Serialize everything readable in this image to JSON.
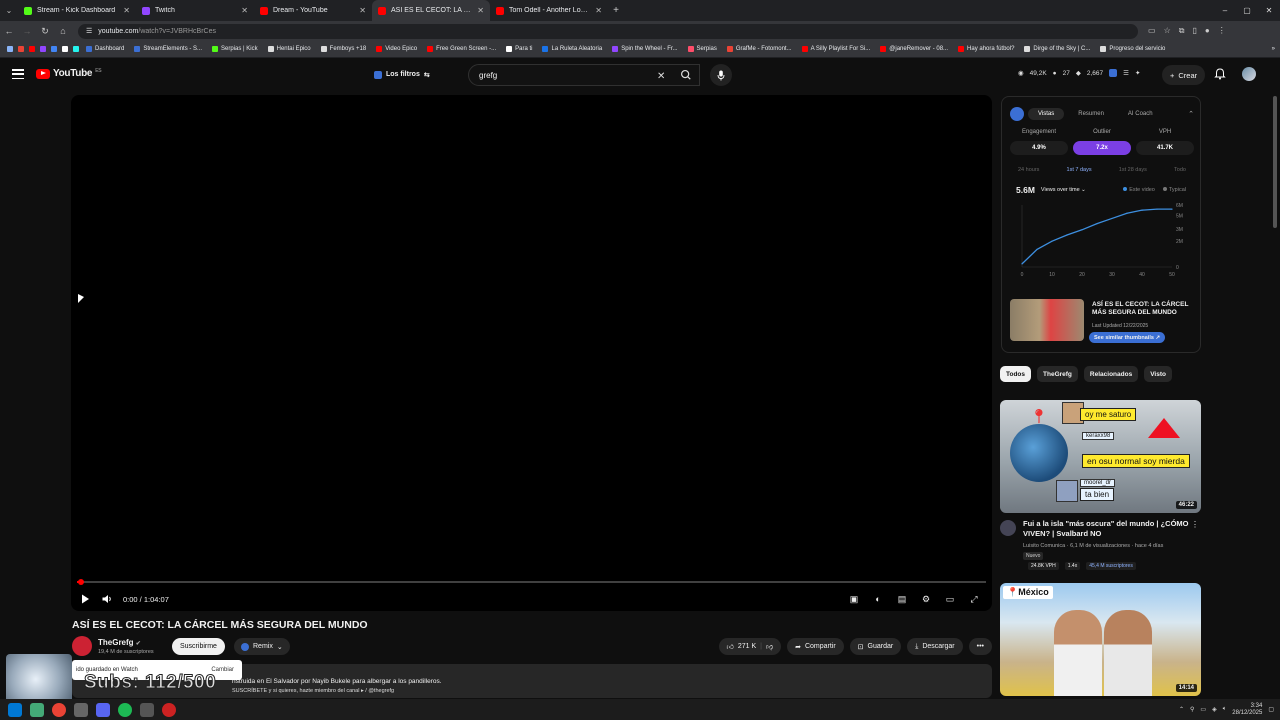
{
  "browser": {
    "tabs": [
      {
        "title": "Stream - Kick Dashboard",
        "color": "#53fc18"
      },
      {
        "title": "Twitch",
        "color": "#9146ff"
      },
      {
        "title": "Dream - YouTube",
        "color": "#ff0000"
      },
      {
        "title": "ASÍ ES EL CECOT: LA CÁRCEL M",
        "color": "#ff0000"
      },
      {
        "title": "Tom Odell - Another Love (sub",
        "color": "#ff0000"
      }
    ],
    "active_tab": 3,
    "url_host": "youtube.com",
    "url_path": "/watch?v=JVBRHcBrCes",
    "bookmarks": [
      "Dashboard",
      "StreamElements - S...",
      "Serpias | Kick",
      "Hentai Epico",
      "Femboys +18",
      "Video Epico",
      "Free Green Screen -...",
      "Para ti",
      "La Ruleta Aleatoria",
      "Spin the Wheel - Fr...",
      "Serpias",
      "GrafMe - Fotomont...",
      "A Silly Playlist For Si...",
      "@janeRemover - 08...",
      "Hay ahora fútbol?",
      "Dirge of the Sky | C...",
      "Progreso del servicio"
    ]
  },
  "header": {
    "logo_text": "YouTube",
    "logo_sup": "ES",
    "filters_label": "Los filtros",
    "search_value": "grefg",
    "stats": [
      "49,2K",
      "27",
      "2,667"
    ],
    "create_label": "Crear"
  },
  "player": {
    "time": "0:00 / 1:04:07",
    "progress_fraction": 0.004
  },
  "video": {
    "title": "ASÍ ES EL CECOT: LA CÁRCEL MÁS SEGURA DEL MUNDO",
    "channel": "TheGrefg",
    "subscribers": "19,4 M de suscriptores",
    "subscribe_label": "Suscribirme",
    "remix_label": "Remix",
    "likes": "271 K",
    "share_label": "Compartir",
    "save_label": "Guardar",
    "download_label": "Descargar",
    "desc_line1": "nstruida en El Salvador por Nayib Bukele para albergar a los pandilleros.",
    "desc_line2": "SUSCRÍBETE y si quieres, hazte miembro del canal ▸ / @thegrefg"
  },
  "overlay": {
    "toast_text": "ido guardado en Watch",
    "toast_action": "Cambiar",
    "subs_goal": "Subs: 112/500"
  },
  "panel": {
    "tabs": [
      "Vistas",
      "Resumen",
      "AI Coach"
    ],
    "metrics": [
      {
        "label": "Engagement",
        "value": "4.9%"
      },
      {
        "label": "Outlier",
        "value": "7.2x"
      },
      {
        "label": "VPH",
        "value": "41.7K"
      }
    ],
    "periods": [
      "24 hours",
      "1st 7 days",
      "1st 28 days",
      "Todo"
    ],
    "views_total": "5.6M",
    "views_select": "Views over time",
    "legend": [
      "Este video",
      "Typical"
    ],
    "thumb_title": "ASÍ ES EL CECOT: LA CÁRCEL MÁS SEGURA DEL MUNDO",
    "thumb_date": "Last Updated 12/22/2025",
    "similar_label": "See similar thumbnails"
  },
  "chart_data": {
    "type": "line",
    "x": [
      0,
      5,
      10,
      15,
      20,
      25,
      30,
      35,
      40,
      45,
      50
    ],
    "series": [
      {
        "name": "Este video",
        "values": [
          0.3,
          1.7,
          2.5,
          3.1,
          3.6,
          4.2,
          4.7,
          5.2,
          5.5,
          5.6,
          5.6
        ]
      }
    ],
    "xticks": [
      "0",
      "10",
      "20",
      "30",
      "40",
      "50"
    ],
    "yticks": [
      "6M",
      "5M",
      "3M",
      "2M",
      "0"
    ],
    "ylim": [
      0,
      6
    ]
  },
  "chips": [
    "Todos",
    "TheGrefg",
    "Relacionados",
    "Visto"
  ],
  "recs": [
    {
      "title": "Fui a la isla \"más oscura\" del mundo | ¿CÓMO VIVEN? | Svalbard NO",
      "meta": "Luisito Comunica · 6,1 M de visualizaciones · hace 4 días",
      "badge": "Nuevo",
      "stats": [
        "24.8K VPH",
        "1.4x",
        "45,4 M suscriptores"
      ],
      "duration": "46:22",
      "bubbles": [
        "oy me saturo",
        "en osu normal soy mierda",
        "ta bien"
      ],
      "names": [
        "keraxx98",
        "moorel_dr"
      ]
    },
    {
      "country": "📍México",
      "duration": "14:14"
    }
  ],
  "taskbar": {
    "time": "3:34",
    "date": "28/12/2025"
  }
}
